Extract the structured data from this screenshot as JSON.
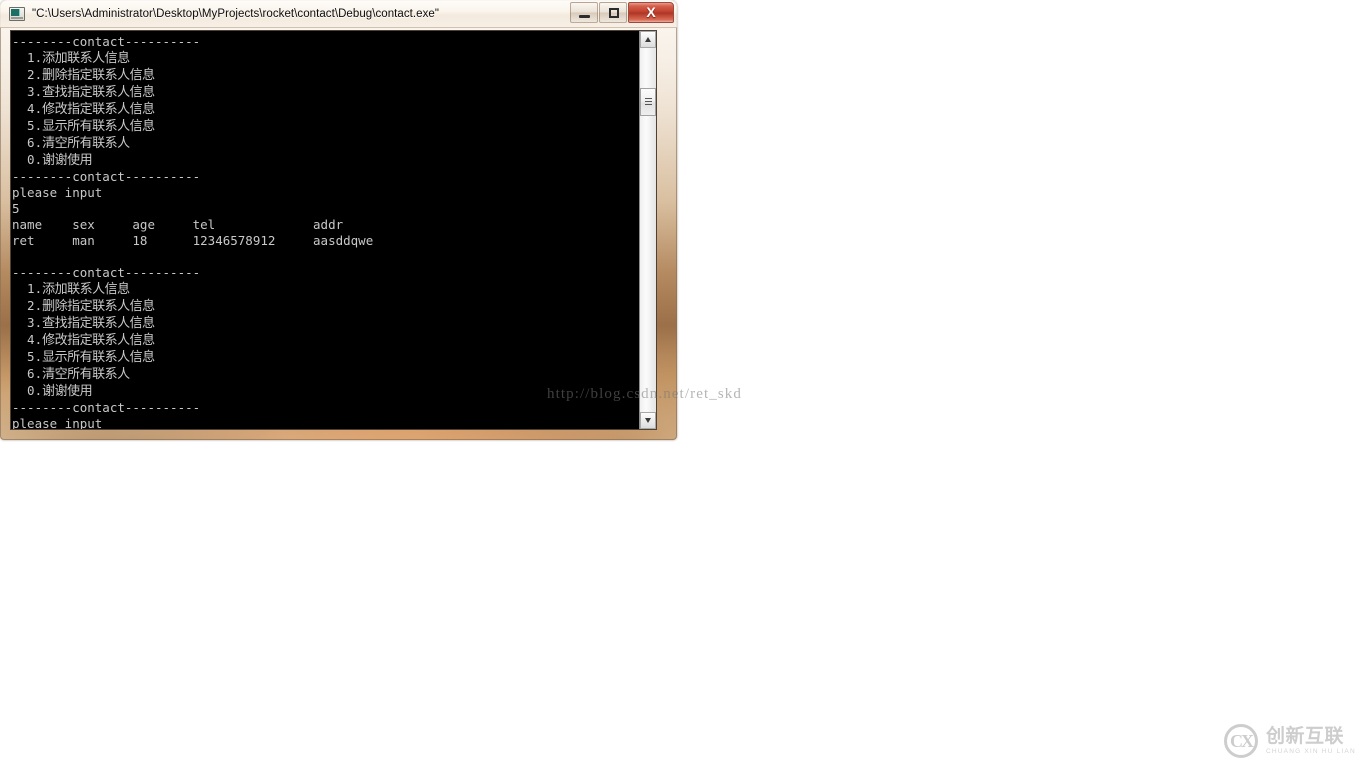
{
  "desktop": {
    "background_color": "#ffffff"
  },
  "window": {
    "title": "\"C:\\Users\\Administrator\\Desktop\\MyProjects\\rocket\\contact\\Debug\\contact.exe\"",
    "icon": "console-app-icon",
    "controls": {
      "minimize_label": "─",
      "maximize_label": "□",
      "close_label": "X"
    },
    "frame_color": "#c89a68",
    "titlebar_color": "#f7f0e7"
  },
  "console": {
    "background_color": "#000000",
    "text_color": "#c8c8c8",
    "separator_top": "--------contact----------",
    "separator_bottom": "--------contact----------",
    "menu_items": [
      "1.添加联系人信息",
      "2.删除指定联系人信息",
      "3.查找指定联系人信息",
      "4.修改指定联系人信息",
      "5.显示所有联系人信息",
      "6.清空所有联系人",
      "0.谢谢使用"
    ],
    "prompt": "please input",
    "user_input": "5",
    "table": {
      "headers": [
        "name",
        "sex",
        "age",
        "tel",
        "addr"
      ],
      "rows": [
        [
          "ret",
          "man",
          "18",
          "12346578912",
          "aasddqwe"
        ]
      ]
    },
    "lines": [
      "--------contact----------",
      "  1.添加联系人信息",
      "  2.删除指定联系人信息",
      "  3.查找指定联系人信息",
      "  4.修改指定联系人信息",
      "  5.显示所有联系人信息",
      "  6.清空所有联系人",
      "  0.谢谢使用",
      "--------contact----------",
      "please input",
      "5",
      "name    sex     age     tel             addr",
      "ret     man     18      12346578912     aasddqwe",
      "",
      "--------contact----------",
      "  1.添加联系人信息",
      "  2.删除指定联系人信息",
      "  3.查找指定联系人信息",
      "  4.修改指定联系人信息",
      "  5.显示所有联系人信息",
      "  6.清空所有联系人",
      "  0.谢谢使用",
      "--------contact----------",
      "please input"
    ],
    "scrollbar": {
      "up_arrow": "▲",
      "down_arrow": "▼",
      "thumb_position_percent": 12
    }
  },
  "watermark": {
    "text_left": "http://blog",
    "text_right": ".csdn.net/ret_skd",
    "full_text": "http://blog.csdn.net/ret_skd",
    "color": "#787878"
  },
  "logo": {
    "mark": "CX",
    "name_cn": "创新互联",
    "name_en": "CHUANG XIN HU LIAN",
    "color": "#9c9c9c"
  }
}
